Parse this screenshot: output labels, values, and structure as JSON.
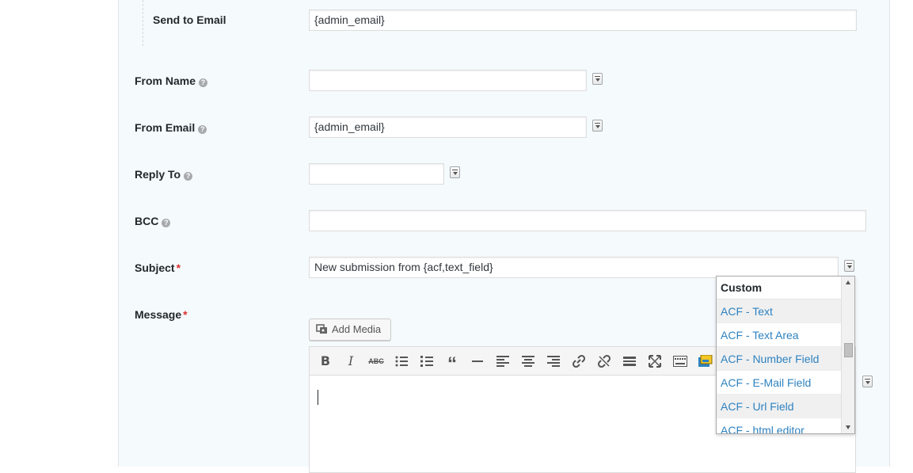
{
  "fields": {
    "send_to_email": {
      "label": "Send to Email",
      "value": "{admin_email}"
    },
    "from_name": {
      "label": "From Name",
      "value": ""
    },
    "from_email": {
      "label": "From Email",
      "value": "{admin_email}"
    },
    "reply_to": {
      "label": "Reply To",
      "value": ""
    },
    "bcc": {
      "label": "BCC",
      "value": ""
    },
    "subject": {
      "label": "Subject",
      "required_mark": "*",
      "value": "New submission from {acf,text_field}"
    },
    "message": {
      "label": "Message",
      "required_mark": "*"
    }
  },
  "help_icon_glyph": "?",
  "editor": {
    "add_media_label": "Add Media",
    "toolbar": [
      "bold-icon",
      "italic-icon",
      "strikethrough-icon",
      "bullet-list-icon",
      "numbered-list-icon",
      "blockquote-icon",
      "horizontal-line-icon",
      "align-left-icon",
      "align-center-icon",
      "align-right-icon",
      "link-icon",
      "unlink-icon",
      "read-more-icon",
      "fullscreen-icon",
      "toolbar-toggle-icon",
      "gravity-forms-icon"
    ]
  },
  "merge_dropdown": {
    "header": "Custom",
    "items": [
      "ACF - Text",
      "ACF - Text Area",
      "ACF - Number Field",
      "ACF - E-Mail Field",
      "ACF - Url Field",
      "ACF - html editor"
    ]
  },
  "colors": {
    "panel_bg": "#f5fafd",
    "link_blue": "#2e82c0",
    "required_red": "#dc3232"
  }
}
